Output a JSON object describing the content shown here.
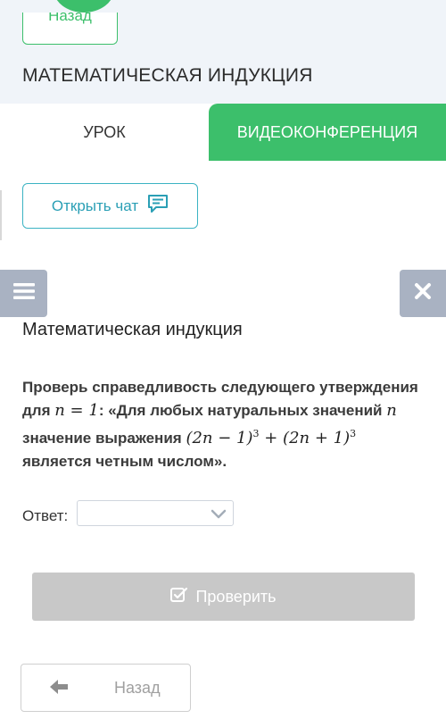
{
  "header": {
    "back_label": "Назад",
    "title": "МАТЕМАТИЧЕСКАЯ ИНДУКЦИЯ"
  },
  "tabs": [
    {
      "label": "УРОК",
      "active": true
    },
    {
      "label": "ВИДЕОКОНФЕРЕНЦИЯ",
      "active": false
    }
  ],
  "chat": {
    "label": "Открыть чат",
    "icon": "chat-icon"
  },
  "toolbar": {
    "menu_icon": "hamburger-icon",
    "close_icon": "close-icon"
  },
  "exercise": {
    "section_title": "Математическая индукция",
    "question": {
      "part1": "Проверь справедливость следующего утверждения для ",
      "math1": "n = 1",
      "part2": ": «Для любых натуральных значений ",
      "math2": "n",
      "part3": " значение выражения ",
      "math3a": "(2n − 1)",
      "exp3a": "3",
      "math3b": " + (2n + 1)",
      "exp3b": "3",
      "part4": " является четным числом»."
    },
    "answer_label": "Ответ:",
    "answer_value": "",
    "check_label": "Проверить",
    "back_label": "Назад"
  },
  "colors": {
    "accent_green": "#3cbf6b",
    "chat_teal": "#2a9fb5",
    "side_button_gray": "#a9b2c2",
    "disabled_button": "#c8c8c8",
    "header_band": "#f0f4f9"
  }
}
